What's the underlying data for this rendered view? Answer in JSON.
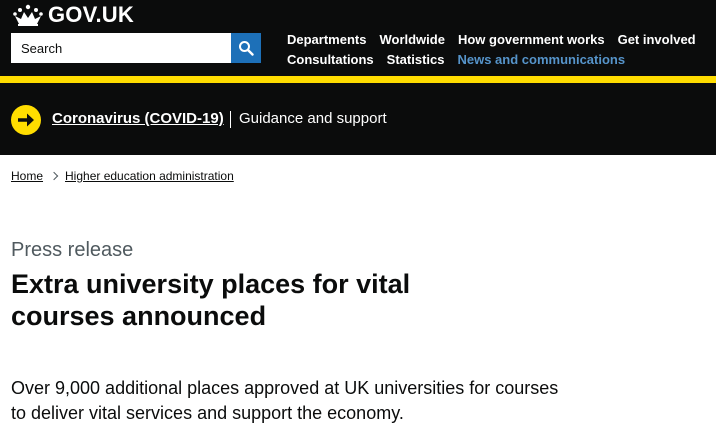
{
  "header": {
    "logo_text": "GOV.UK",
    "search": {
      "placeholder": "Search",
      "button_icon": "search-icon"
    },
    "nav_row_1": [
      "Departments",
      "Worldwide",
      "How government works",
      "Get involved"
    ],
    "nav_row_2": [
      "Consultations",
      "Statistics",
      "News and communications"
    ],
    "active_nav": "News and communications"
  },
  "banner": {
    "link_text": "Coronavirus (COVID-19)",
    "text": "Guidance and support",
    "icon": "arrow-right-icon"
  },
  "breadcrumb": [
    "Home",
    "Higher education administration"
  ],
  "page": {
    "caption": "Press release",
    "title": "Extra university places for vital courses announced",
    "lead": "Over 9,000 additional places approved at UK universities for courses to deliver vital services and support the economy."
  },
  "colors": {
    "header_bg": "#0b0c0c",
    "yellow": "#ffdd00",
    "search_button": "#1d70b8",
    "active_link": "#5694ca",
    "secondary_text": "#505a5f"
  }
}
